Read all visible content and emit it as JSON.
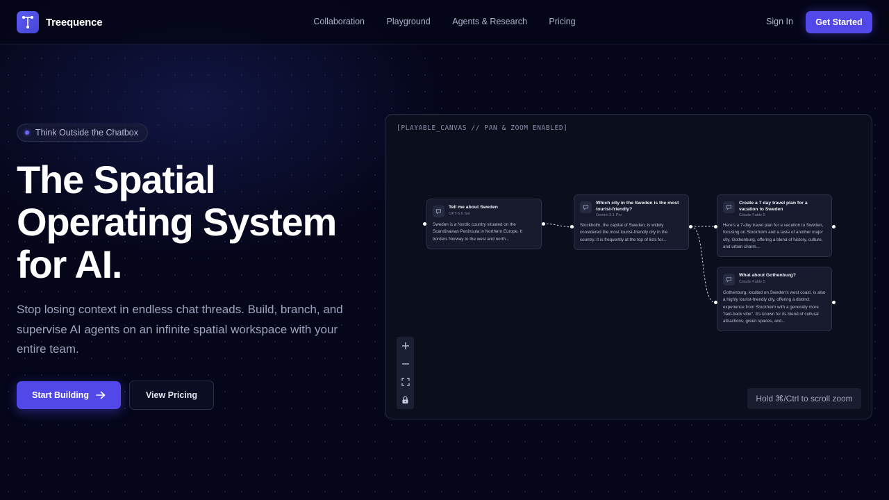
{
  "brand": {
    "name": "Treequence",
    "logo_icon": "tree-branch-icon"
  },
  "nav": {
    "links": [
      "Collaboration",
      "Playground",
      "Agents & Research",
      "Pricing"
    ],
    "sign_in": "Sign In",
    "get_started": "Get Started"
  },
  "hero": {
    "badge": "Think Outside the Chatbox",
    "headline": [
      "The Spatial",
      "Operating System",
      "for AI."
    ],
    "subheadline": "Stop losing context in endless chat threads. Build, branch, and supervise AI agents on an infinite spatial workspace with your entire team.",
    "primary_cta": "Start Building",
    "primary_cta_icon": "arrow-right-icon",
    "secondary_cta": "View Pricing"
  },
  "canvas": {
    "label": "[PLAYABLE_CANVAS // PAN & ZOOM ENABLED]",
    "nodes": [
      {
        "title": "Tell me about Sweden",
        "model": "OPT-5.6 Sol",
        "body": "Sweden is a Nordic country situated on the Scandinavian Peninsula in Northern Europe. It borders Norway to the west and north..."
      },
      {
        "title": "Which city in the Sweden is the most tourist-friendly?",
        "model": "Gemini 3.1 Pro",
        "body": "Stockholm, the capital of Sweden, is widely considered the most tourist-friendly city in the country. It is frequently at the top of lists for..."
      },
      {
        "title": "Create a 7 day travel plan for a vacation to Sweden",
        "model": "Claude Fable 5",
        "body": "Here's a 7-day travel plan for a vacation to Sweden, focusing on Stockholm and a taste of another major city, Gothenburg, offering a blend of history, culture, and urban charm..."
      },
      {
        "title": "What about Gothenburg?",
        "model": "Claude Fable 5",
        "body": "Gothenburg, located on Sweden's west coast, is also a highly tourist-friendly city, offering a distinct experience from Stockholm with a generally more \"laid-back vibe\". It's known for its blend of cultural attractions, green spaces, and..."
      }
    ],
    "zoom_controls": [
      "zoom-in-icon",
      "zoom-out-icon",
      "fit-view-icon",
      "lock-icon"
    ],
    "zoom_hint": "Hold ⌘/Ctrl to scroll zoom"
  },
  "colors": {
    "accent": "#5248ea",
    "background": "#05061a",
    "canvas": "#0b0e1c",
    "node": "#161a2c"
  }
}
